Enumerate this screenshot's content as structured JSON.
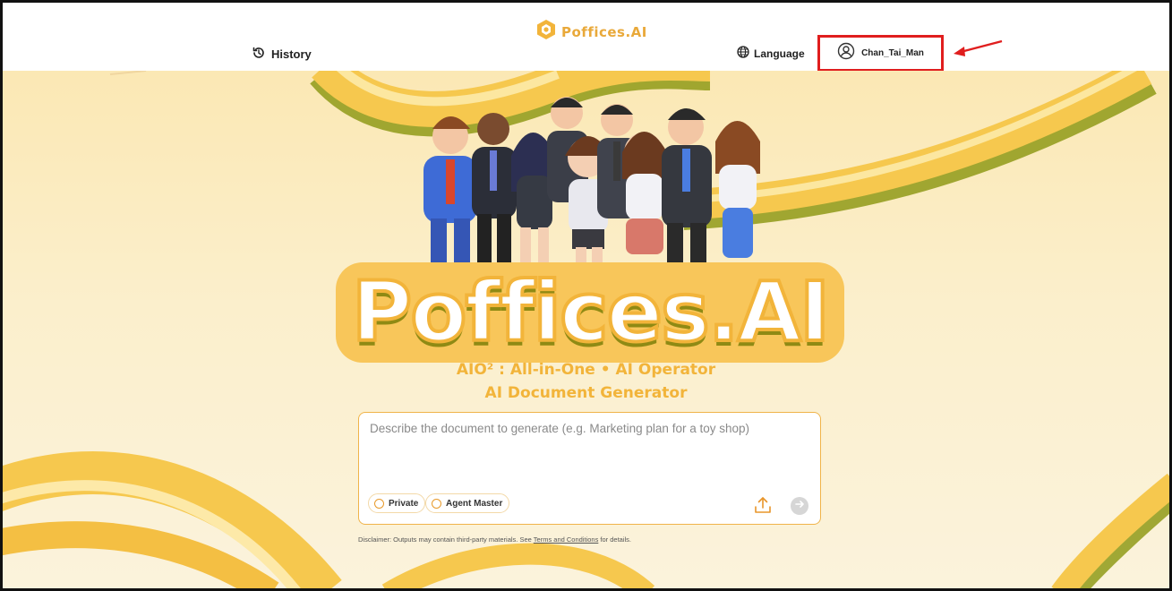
{
  "header": {
    "history_label": "History",
    "brand_name": "Poffices.AI",
    "language_label": "Language",
    "user_name": "Chan_Tai_Man"
  },
  "hero": {
    "logo_text": "Poffices.AI",
    "tagline_line1": "AIO² : All-in-One • AI Operator",
    "tagline_line2": "AI Document Generator"
  },
  "prompt": {
    "placeholder": "Describe the document to generate (e.g. Marketing plan for a toy shop)",
    "value": "",
    "options": [
      {
        "label": "Private"
      },
      {
        "label": "Agent Master"
      }
    ]
  },
  "disclaimer": {
    "prefix": "Disclaimer: Outputs may contain third-party materials. See ",
    "link_text": "Terms and Conditions",
    "suffix": " for details."
  },
  "colors": {
    "brand_accent": "#f2b43a",
    "highlight_border": "#e01e1e",
    "background_top": "#fbe8b4",
    "olive_shadow": "#8f8a14"
  },
  "icons": {
    "history": "history-icon",
    "brand": "brand-logo-icon",
    "language": "globe-icon",
    "user": "user-circle-icon",
    "upload": "upload-icon",
    "send": "send-arrow-icon"
  }
}
